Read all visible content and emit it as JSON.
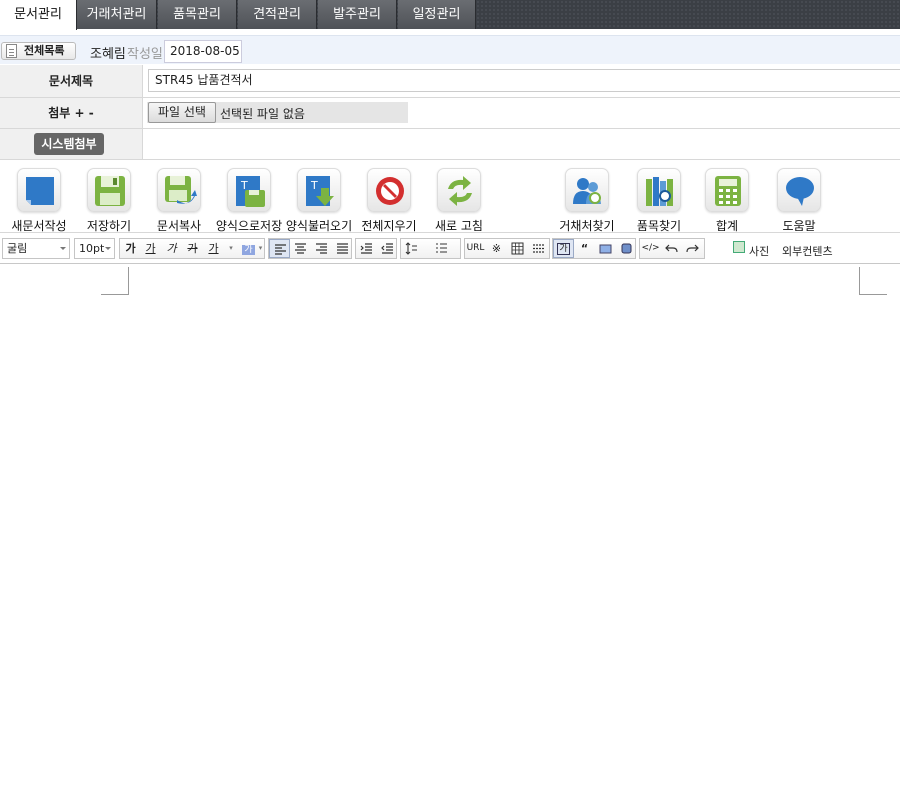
{
  "tabs": [
    {
      "label": "문서관리",
      "active": true
    },
    {
      "label": "거래처관리",
      "active": false
    },
    {
      "label": "품목관리",
      "active": false
    },
    {
      "label": "견적관리",
      "active": false
    },
    {
      "label": "발주관리",
      "active": false
    },
    {
      "label": "일정관리",
      "active": false
    }
  ],
  "docbar": {
    "list_button": "전체목록",
    "author": "조혜림",
    "date_label": "작성일",
    "date_value": "2018-08-05"
  },
  "form": {
    "title_label": "문서제목",
    "title_value": "STR45 납품견적서",
    "attach_label": "첨부 + -",
    "file_button": "파일 선택",
    "file_none": "선택된 파일 없음",
    "system_attach": "시스템첨부"
  },
  "tools": [
    {
      "label": "새문서작성",
      "icon": "new-document-icon"
    },
    {
      "label": "저장하기",
      "icon": "save-icon"
    },
    {
      "label": "문서복사",
      "icon": "copy-document-icon"
    },
    {
      "label": "양식으로저장",
      "icon": "save-template-icon"
    },
    {
      "label": "양식불러오기",
      "icon": "load-template-icon"
    },
    {
      "label": "전체지우기",
      "icon": "clear-all-icon"
    },
    {
      "label": "새로 고침",
      "icon": "refresh-icon"
    },
    {
      "label": "거채처찾기",
      "icon": "find-customer-icon"
    },
    {
      "label": "품목찾기",
      "icon": "find-item-icon"
    },
    {
      "label": "합계",
      "icon": "calculator-icon"
    },
    {
      "label": "도움말",
      "icon": "help-icon"
    }
  ],
  "editor": {
    "font": "굴림",
    "size": "10pt",
    "bold": "가",
    "underline": "가",
    "italic": "가",
    "strike": "가",
    "font_color": "가",
    "bg_color": "가",
    "url": "URL",
    "special_char": "※",
    "quote": "“",
    "source": "</>",
    "photo": "사진",
    "external": "외부컨텐츠",
    "char_box": "가"
  },
  "colors": {
    "tab_bg": "#4f5257",
    "docbar_bg": "#eef3fb",
    "label_bg": "#f0f0f0",
    "sys_button": "#666666"
  }
}
